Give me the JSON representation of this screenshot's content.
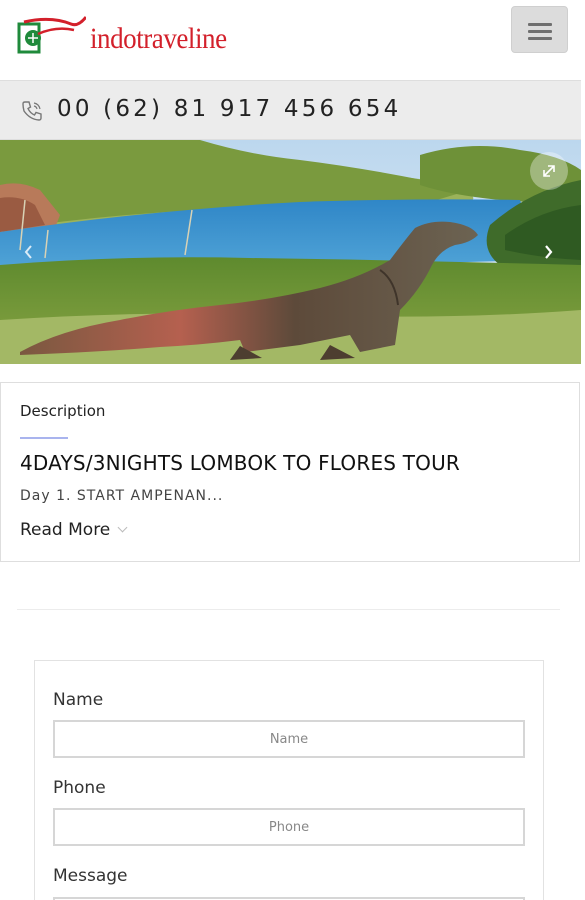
{
  "header": {
    "logo_text": "indotraveline",
    "menu_icon": "hamburger-icon"
  },
  "contact": {
    "phone_icon": "phone-icon",
    "phone": "00 (62) 81 917 456 654"
  },
  "hero": {
    "image": "komodo-dragon-on-grassy-hill-above-bay",
    "prev_icon": "chevron-left-icon",
    "next_icon": "chevron-right-icon",
    "expand_icon": "expand-icon"
  },
  "description": {
    "label": "Description",
    "title": "4DAYS/3NIGHTS LOMBOK TO FLORES TOUR",
    "excerpt": "Day 1. START AMPENAN...",
    "read_more": "Read More"
  },
  "form": {
    "name_label": "Name",
    "name_placeholder": "Name",
    "phone_label": "Phone",
    "phone_placeholder": "Phone",
    "message_label": "Message"
  },
  "colors": {
    "brand_red": "#d3202b",
    "brand_green": "#1f8a3b",
    "accent_underline": "#a9b4ee"
  }
}
